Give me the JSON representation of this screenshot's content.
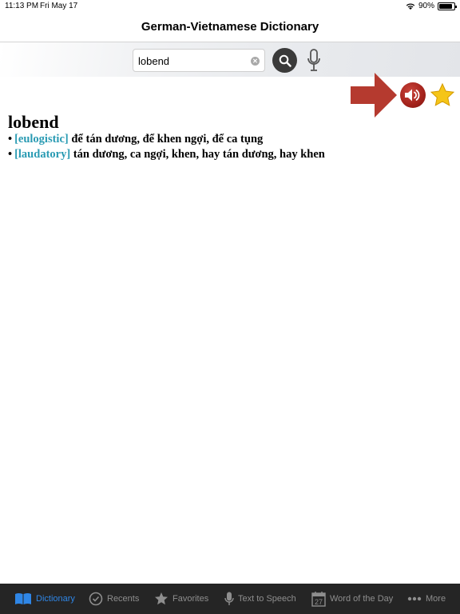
{
  "status_bar": {
    "time": "11:13 PM",
    "date": "Fri May 17",
    "battery": "90%",
    "battery_level": 0.9
  },
  "nav": {
    "title": "German-Vietnamese Dictionary"
  },
  "search": {
    "value": "lobend",
    "placeholder": ""
  },
  "entry": {
    "headword": "lobend",
    "senses": [
      {
        "tag": "[eulogistic]",
        "meaning": "để tán dương, để khen ngợi, để ca tụng"
      },
      {
        "tag": "[laudatory]",
        "meaning": "tán dương, ca ngợi, khen, hay tán dương, hay khen"
      }
    ]
  },
  "tabs": [
    {
      "label": "Dictionary",
      "icon": "book-icon",
      "active": true
    },
    {
      "label": "Recents",
      "icon": "clock-check-icon",
      "active": false
    },
    {
      "label": "Favorites",
      "icon": "star-icon",
      "active": false
    },
    {
      "label": "Text to Speech",
      "icon": "microphone-icon",
      "active": false
    },
    {
      "label": "Word of the Day",
      "icon": "calendar-icon",
      "calendar_day": "27",
      "active": false
    },
    {
      "label": "More",
      "icon": "more-dots-icon",
      "active": false
    }
  ],
  "colors": {
    "accent": "#2f86e6",
    "tag": "#2a9bb3",
    "speaker": "#a3221b",
    "arrow": "#b53a2f",
    "star": "#f5c518",
    "tab_bar": "#252525"
  }
}
